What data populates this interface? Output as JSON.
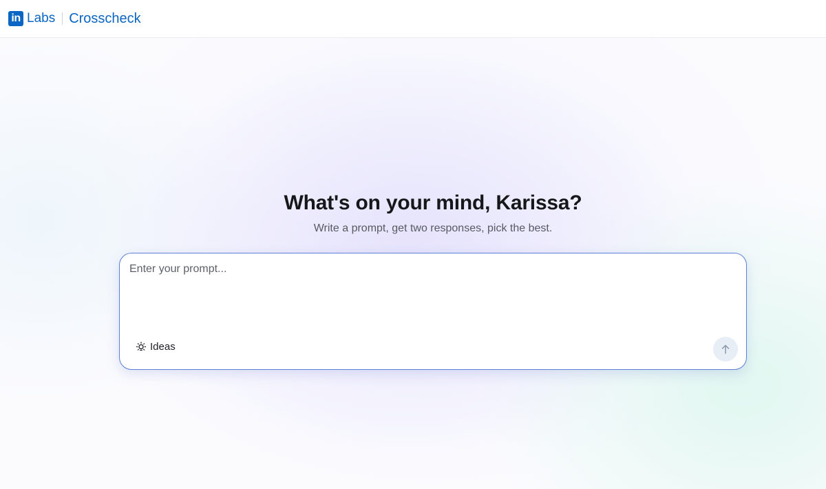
{
  "header": {
    "logo_mark": "in",
    "logo_text": "Labs",
    "app_name": "Crosscheck"
  },
  "hero": {
    "greeting": "What's on your mind, Karissa?",
    "subtitle": "Write a prompt, get two responses, pick the best."
  },
  "prompt": {
    "placeholder": "Enter your prompt...",
    "value": "",
    "ideas_label": "Ideas",
    "ideas_icon": "lightbulb-icon",
    "send_icon": "arrow-up-icon"
  },
  "colors": {
    "brand": "#0a66c2",
    "card_border": "#5b7fd6",
    "send_button_bg": "#e8eef5"
  }
}
